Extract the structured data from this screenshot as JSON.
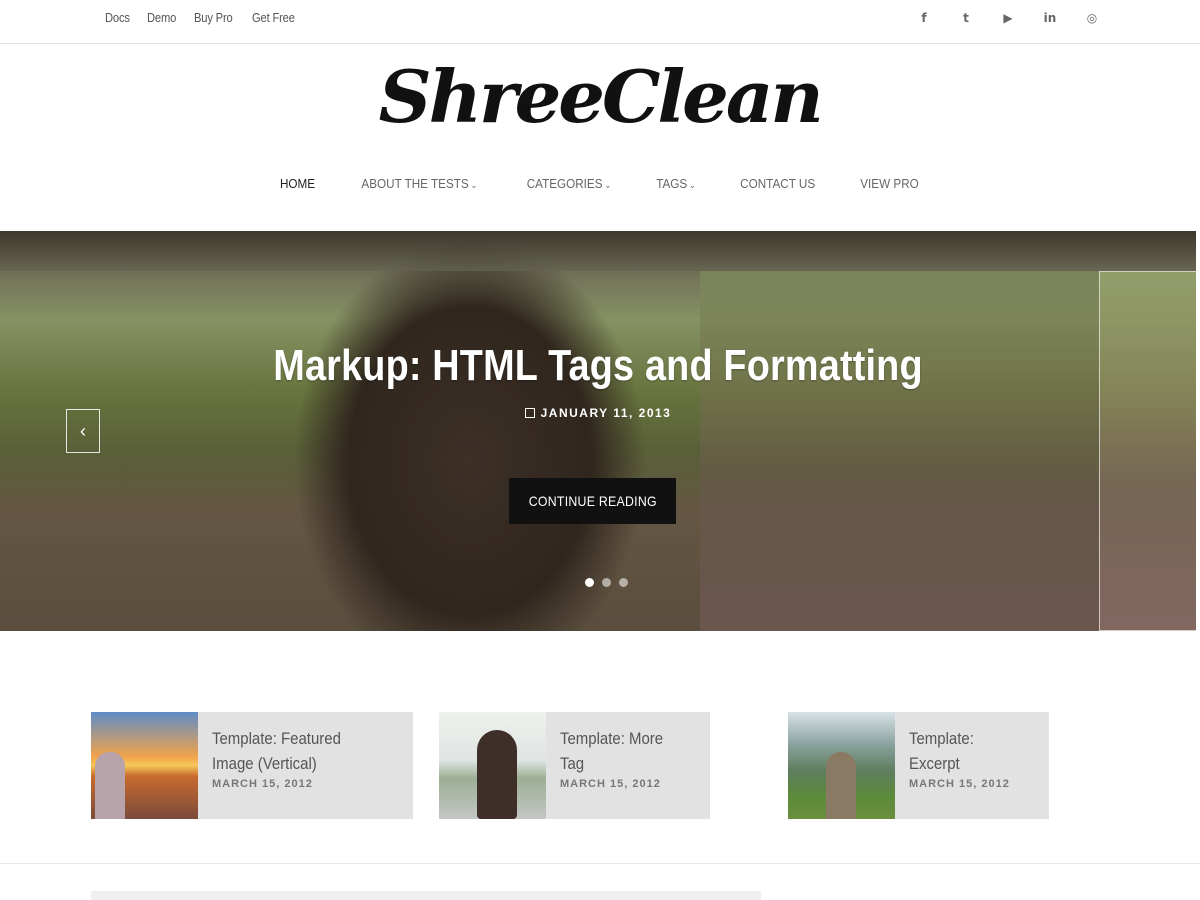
{
  "topbar": {
    "links": [
      "Docs",
      "Demo",
      "Buy Pro",
      "Get Free"
    ],
    "social": [
      {
        "icon": "facebook-icon",
        "glyph": "f"
      },
      {
        "icon": "twitter-icon",
        "glyph": "t"
      },
      {
        "icon": "youtube-icon",
        "glyph": "▶"
      },
      {
        "icon": "linkedin-icon",
        "glyph": "in"
      },
      {
        "icon": "instagram-icon",
        "glyph": "◎"
      }
    ]
  },
  "site": {
    "logo_text": "ShreeClean"
  },
  "nav": {
    "items": [
      {
        "label": "HOME",
        "active": true,
        "has_caret": false
      },
      {
        "label": "ABOUT THE TESTS",
        "active": false,
        "has_caret": true
      },
      {
        "label": "CATEGORIES",
        "active": false,
        "has_caret": true
      },
      {
        "label": "TAGS",
        "active": false,
        "has_caret": true
      },
      {
        "label": "CONTACT US",
        "active": false,
        "has_caret": false
      },
      {
        "label": "VIEW PRO",
        "active": false,
        "has_caret": false
      }
    ]
  },
  "slider": {
    "title": "Markup: HTML Tags and Formatting",
    "date": "JANUARY 11, 2013",
    "cta_label": "CONTINUE READING",
    "prev_glyph": "‹",
    "next_glyph": "›",
    "slides_total": 3,
    "active_index": 0
  },
  "featured": [
    {
      "title": "Template: Featured Image (Vertical)",
      "date": "MARCH 15, 2012"
    },
    {
      "title": "Template: More Tag",
      "date": "MARCH 15, 2012"
    },
    {
      "title": "Template: Excerpt",
      "date": "MARCH 15, 2012"
    }
  ],
  "colors": {
    "accent": "#111111",
    "card_bg": "#e2e2e2"
  }
}
